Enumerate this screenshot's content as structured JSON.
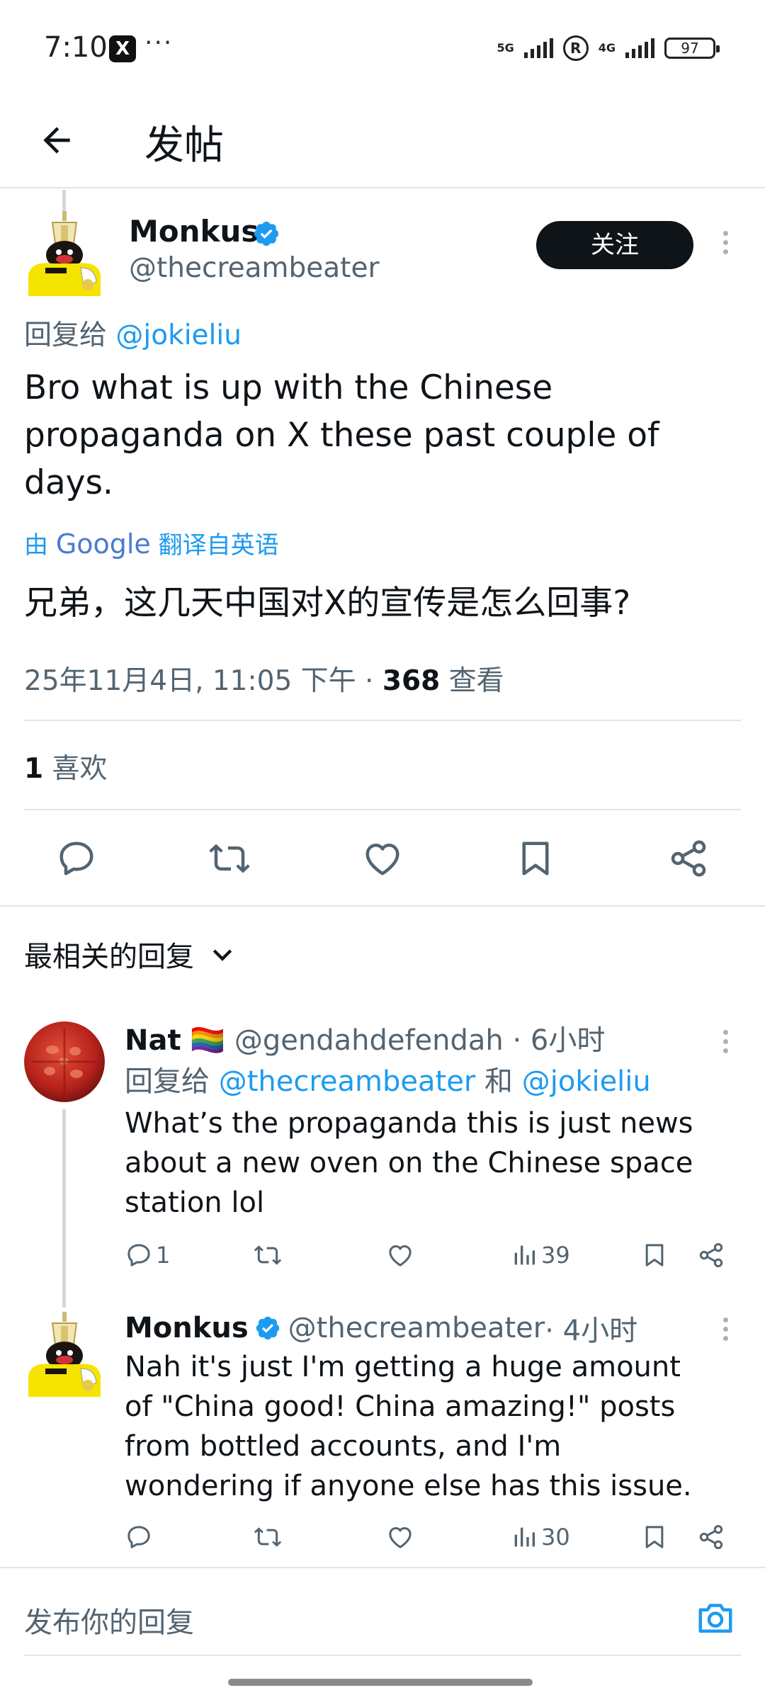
{
  "status_bar": {
    "time": "7:10",
    "app_badge": "X",
    "more_indicator": "···",
    "network_1": "5G",
    "network_2": "4G",
    "registered": "R",
    "battery": "97"
  },
  "header": {
    "title": "发帖"
  },
  "main_post": {
    "author_name": "Monkus",
    "author_handle": "@thecreambeater",
    "follow_label": "关注",
    "reply_prefix": "回复给",
    "reply_to": "@jokieliu",
    "text": "Bro what is up with the Chinese propaganda on X these past couple of days.",
    "translation_by": "由",
    "translation_provider": "Google",
    "translation_from": "翻译自英语",
    "translated_text": "兄弟，这几天中国对X的宣传是怎么回事?",
    "timestamp": "25年11月4日, 11:05 下午 · ",
    "views_count": "368",
    "views_label": " 查看",
    "likes_count": "1",
    "likes_label": " 喜欢"
  },
  "replies_filter": {
    "label": "最相关的回复"
  },
  "replies": [
    {
      "author_name": "Nat",
      "flag": "🏳️‍🌈",
      "author_handle": "@gendahdefendah",
      "time": " · 6小时",
      "reply_prefix": "回复给 ",
      "reply_to_1": "@thecreambeater",
      "reply_and": " 和 ",
      "reply_to_2": "@jokieliu",
      "text": "What’s the propaganda this is just news about a new oven on the Chinese space station lol",
      "reply_count": "1",
      "views": "39"
    },
    {
      "author_name": "Monkus",
      "author_handle": "@thecreambeater",
      "time": " · 4小时",
      "text": "Nah it's just I'm getting a huge amount of \"China good! China amazing!\" posts from bottled accounts, and I'm wondering if anyone else has this issue.",
      "views": "30"
    }
  ],
  "compose": {
    "placeholder": "发布你的回复"
  },
  "colors": {
    "link": "#1d9bf0",
    "muted": "#536471",
    "verified": "#1d9bf0",
    "follow_button": "#0f1419"
  }
}
